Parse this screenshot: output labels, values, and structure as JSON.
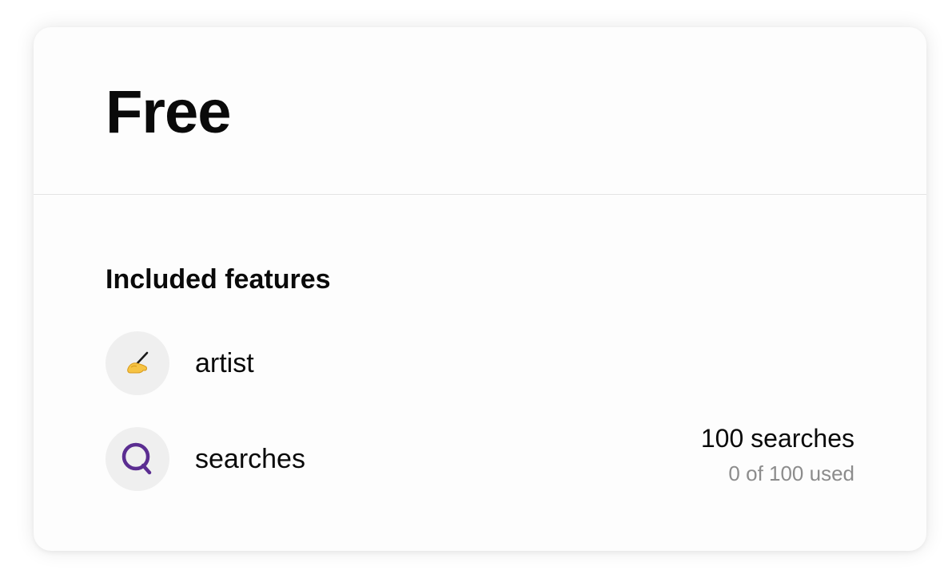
{
  "plan": {
    "name": "Free"
  },
  "features": {
    "heading": "Included features",
    "items": [
      {
        "icon": "writing-hand-icon",
        "label": "artist"
      },
      {
        "icon": "search-icon",
        "label": "searches",
        "total": "100 searches",
        "used": "0 of 100 used"
      }
    ]
  },
  "colors": {
    "search_icon": "#5b2d91",
    "icon_background": "#efefef",
    "muted_text": "#8c8c8c"
  }
}
